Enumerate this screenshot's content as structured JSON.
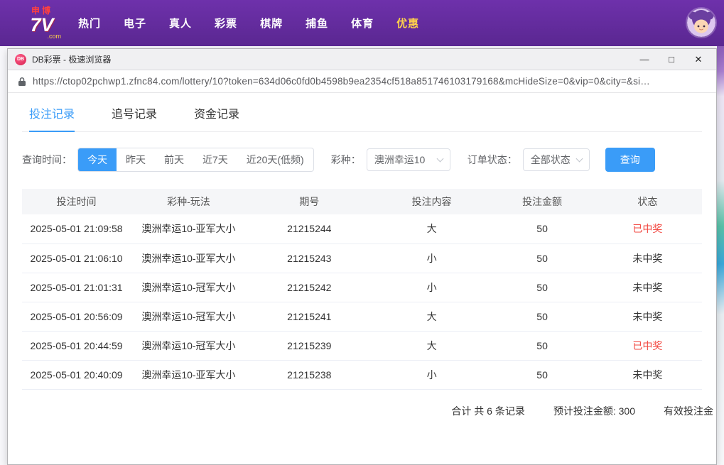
{
  "colors": {
    "accent": "#3a9cf8",
    "win": "#f2443d",
    "nav_top": "#6e31ab",
    "nav_bottom": "#5a2791",
    "highlight": "#ffd24a"
  },
  "site_nav": {
    "logo": {
      "top": "申博",
      "main": "7V",
      "sub": ".com"
    },
    "items": [
      {
        "label": "热门",
        "highlight": false
      },
      {
        "label": "电子",
        "highlight": false
      },
      {
        "label": "真人",
        "highlight": false
      },
      {
        "label": "彩票",
        "highlight": false
      },
      {
        "label": "棋牌",
        "highlight": false
      },
      {
        "label": "捕鱼",
        "highlight": false
      },
      {
        "label": "体育",
        "highlight": false
      },
      {
        "label": "优惠",
        "highlight": true
      }
    ]
  },
  "browser": {
    "favicon_text": "DB",
    "title": "DB彩票 - 极速浏览器",
    "url": "https://ctop02pchwp1.zfnc84.com/lottery/10?token=634d06c0fd0b4598b9ea2354cf518a851746103179168&mcHideSize=0&vip=0&city=&si…",
    "controls": {
      "minimize": "—",
      "maximize": "□",
      "close": "✕"
    }
  },
  "tabs": [
    {
      "label": "投注记录",
      "active": true
    },
    {
      "label": "追号记录",
      "active": false
    },
    {
      "label": "资金记录",
      "active": false
    }
  ],
  "filters": {
    "time_label": "查询时间：",
    "time_options": [
      "今天",
      "昨天",
      "前天",
      "近7天",
      "近20天(低频)"
    ],
    "active_time": "今天",
    "lottery_label": "彩种：",
    "lottery_value": "澳洲幸运10",
    "status_label": "订单状态：",
    "status_value": "全部状态",
    "search_button": "查询"
  },
  "table": {
    "headers": [
      "投注时间",
      "彩种-玩法",
      "期号",
      "投注内容",
      "投注金额",
      "状态"
    ],
    "rows": [
      {
        "time": "2025-05-01 21:09:58",
        "game": "澳洲幸运10-亚军大小",
        "issue": "21215244",
        "content": "大",
        "amount": "50",
        "status": "已中奖",
        "win": true
      },
      {
        "time": "2025-05-01 21:06:10",
        "game": "澳洲幸运10-亚军大小",
        "issue": "21215243",
        "content": "小",
        "amount": "50",
        "status": "未中奖",
        "win": false
      },
      {
        "time": "2025-05-01 21:01:31",
        "game": "澳洲幸运10-冠军大小",
        "issue": "21215242",
        "content": "小",
        "amount": "50",
        "status": "未中奖",
        "win": false
      },
      {
        "time": "2025-05-01 20:56:09",
        "game": "澳洲幸运10-冠军大小",
        "issue": "21215241",
        "content": "大",
        "amount": "50",
        "status": "未中奖",
        "win": false
      },
      {
        "time": "2025-05-01 20:44:59",
        "game": "澳洲幸运10-冠军大小",
        "issue": "21215239",
        "content": "大",
        "amount": "50",
        "status": "已中奖",
        "win": true
      },
      {
        "time": "2025-05-01 20:40:09",
        "game": "澳洲幸运10-亚军大小",
        "issue": "21215238",
        "content": "小",
        "amount": "50",
        "status": "未中奖",
        "win": false
      }
    ],
    "summary": {
      "total": "合计 共 6 条记录",
      "expected": "预计投注金额: 300",
      "valid": "有效投注金"
    }
  }
}
